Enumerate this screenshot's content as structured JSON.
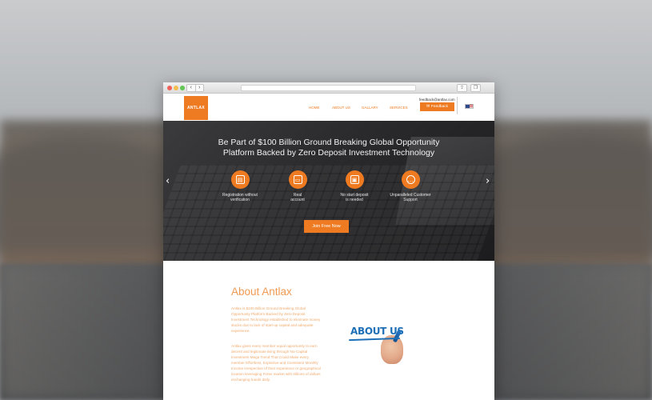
{
  "backdrop": {
    "letters": "G        R"
  },
  "browser": {
    "nav_back": "‹",
    "nav_forward": "›",
    "share_icon": "share-icon",
    "tabs_icon": "tabs-icon"
  },
  "header": {
    "logo": "ANTLAX",
    "menu": [
      "HOME",
      "ABOUT US",
      "GALLARY",
      "SERVICES"
    ],
    "email": "feedback@antlax.com",
    "feedback_label": "Feedback",
    "flag": "us-flag"
  },
  "hero": {
    "title_line1": "Be Part of $100 Billion Ground Breaking Global Opportunity",
    "title_line2": "Platform Backed by Zero Deposit Investment Technology",
    "arrow_left": "‹",
    "arrow_right": "›",
    "features": [
      {
        "line1": "Registration without",
        "line2": "verification",
        "icon": "clipboard-icon"
      },
      {
        "line1": "Real",
        "line2": "account",
        "icon": "briefcase-icon"
      },
      {
        "line1": "No start deposit",
        "line2": "is needed",
        "icon": "wallet-icon"
      },
      {
        "line1": "Unparalleled Customer",
        "line2": "Support",
        "icon": "chat-icon"
      }
    ],
    "cta": "Join Free Now"
  },
  "about": {
    "title": "About Antlax",
    "paragraph1": "Antlax is $100 Billion Ground Breaking Global Opportunity Platform Backed by Zero Deposit Investment Technology established to eliminate money stocks due to lack of start-up capital and adequate experience.",
    "paragraph2": "Antlax gives every member equal opportunity to earn decent and legitimate living through No-Capital Investment Mega Trend That Could Make every member Effortless, Explosive and Consistent Monthly Income irrespective of their experience or geographical location leveraging Forex market with trillions of dollars exchanging hands daily.",
    "image_text": "ABOUT US"
  },
  "colors": {
    "accent": "#ee7b22",
    "about_text": "#f0aa6e",
    "about_us_blue": "#1d6fb8"
  }
}
